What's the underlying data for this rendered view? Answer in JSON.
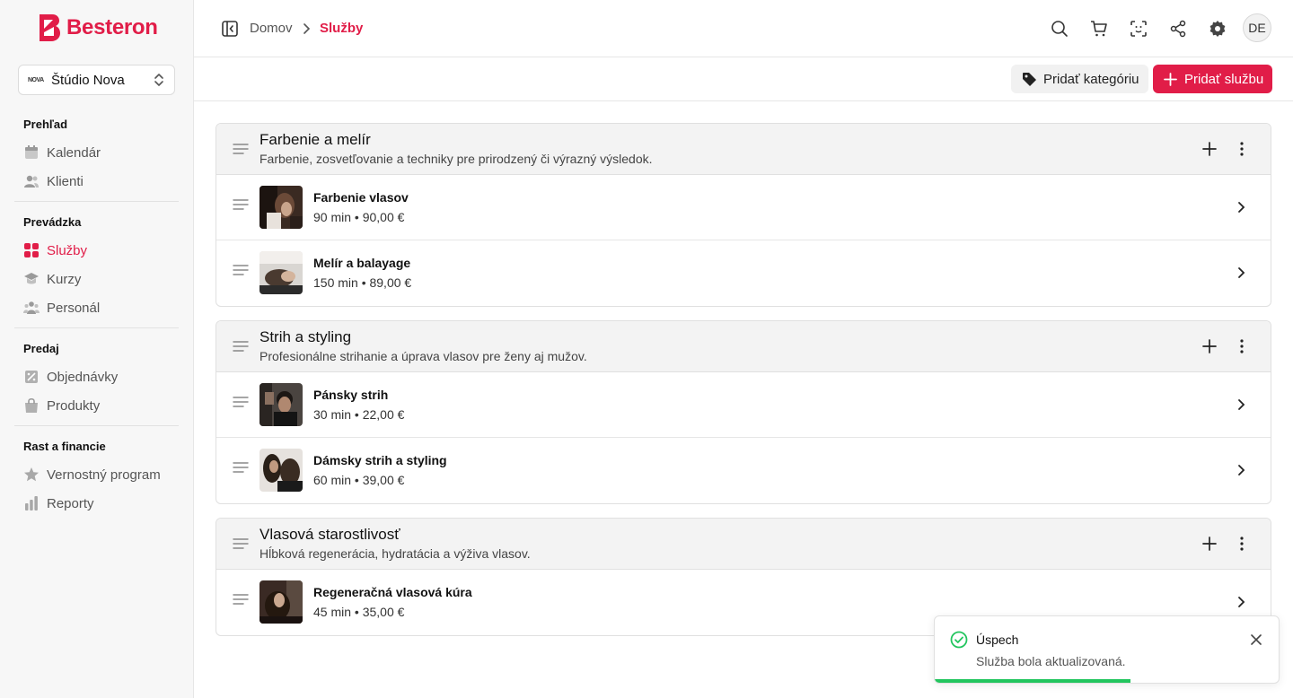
{
  "brand": {
    "name": "Besteron",
    "accent": "#e11d48"
  },
  "studio": {
    "logo_text": "NOVA",
    "name": "Štúdio Nova"
  },
  "sidebar": {
    "sections": [
      {
        "title": "Prehľad",
        "items": [
          {
            "label": "Kalendár",
            "icon": "calendar-icon"
          },
          {
            "label": "Klienti",
            "icon": "users-icon"
          }
        ]
      },
      {
        "title": "Prevádzka",
        "items": [
          {
            "label": "Služby",
            "icon": "grid-icon",
            "active": true
          },
          {
            "label": "Kurzy",
            "icon": "graduation-cap-icon"
          },
          {
            "label": "Personál",
            "icon": "team-icon"
          }
        ]
      },
      {
        "title": "Predaj",
        "items": [
          {
            "label": "Objednávky",
            "icon": "orders-icon"
          },
          {
            "label": "Produkty",
            "icon": "bag-icon"
          }
        ]
      },
      {
        "title": "Rast a financie",
        "items": [
          {
            "label": "Vernostný program",
            "icon": "star-icon"
          },
          {
            "label": "Reporty",
            "icon": "bar-chart-icon"
          }
        ]
      }
    ]
  },
  "header": {
    "breadcrumb": {
      "home": "Domov",
      "current": "Služby"
    },
    "avatar_initials": "DE"
  },
  "toolbar": {
    "add_category_label": "Pridať kategóriu",
    "add_service_label": "Pridať službu"
  },
  "categories": [
    {
      "title": "Farbenie a melír",
      "description": "Farbenie, zosvetľovanie a techniky pre prirodzený či výrazný výsledok.",
      "services": [
        {
          "name": "Farbenie vlasov",
          "meta": "90 min • 90,00 €"
        },
        {
          "name": "Melír a balayage",
          "meta": "150 min • 89,00 €"
        }
      ]
    },
    {
      "title": "Strih a styling",
      "description": "Profesionálne strihanie a úprava vlasov pre ženy aj mužov.",
      "services": [
        {
          "name": "Pánsky strih",
          "meta": "30 min • 22,00 €"
        },
        {
          "name": "Dámsky strih a styling",
          "meta": "60 min • 39,00 €"
        }
      ]
    },
    {
      "title": "Vlasová starostlivosť",
      "description": "Hĺbková regenerácia, hydratácia a výživa vlasov.",
      "services": [
        {
          "name": "Regeneračná vlasová kúra",
          "meta": "45 min • 35,00 €"
        }
      ]
    }
  ],
  "toast": {
    "title": "Úspech",
    "message": "Služba bola aktualizovaná.",
    "progress": 0.57,
    "color": "#22c55e"
  }
}
